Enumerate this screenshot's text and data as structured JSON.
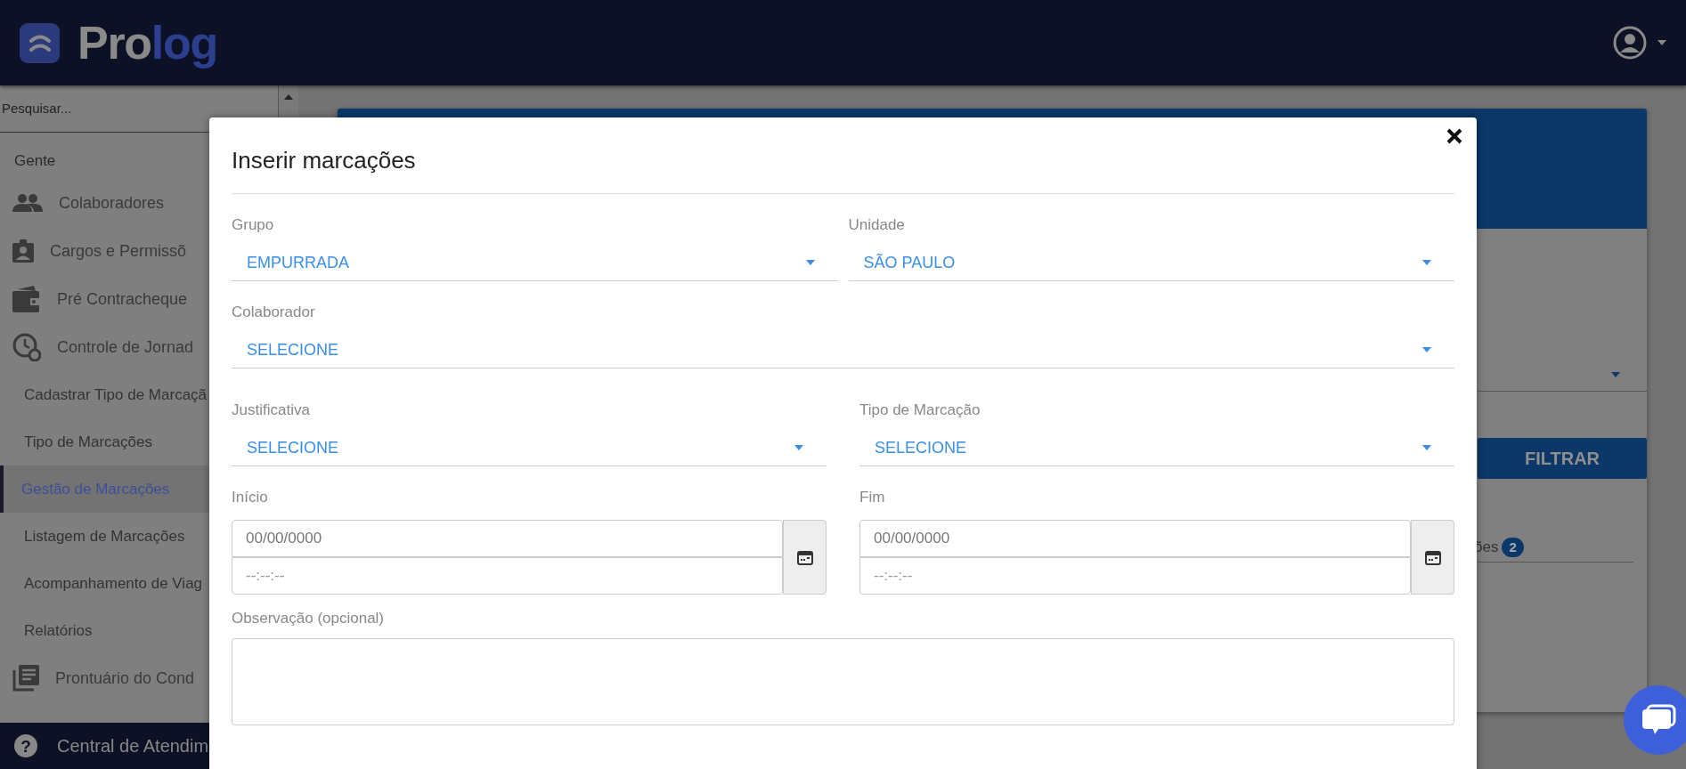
{
  "header": {
    "logo": {
      "parts": [
        "Pro",
        "log"
      ]
    }
  },
  "sidebar": {
    "search": {
      "placeholder": "Pesquisar..."
    },
    "items": [
      {
        "kind": "section",
        "label": "Gente"
      },
      {
        "kind": "main",
        "label": "Colaboradores",
        "selected": false
      },
      {
        "kind": "main",
        "label": "Cargos e Permissõ",
        "selected": false
      },
      {
        "kind": "main",
        "label": "Pré Contracheque",
        "selected": false
      },
      {
        "kind": "main",
        "label": "Controle de Jornad",
        "selected": false
      },
      {
        "kind": "sub",
        "label": "Cadastrar Tipo de Marcaçã",
        "selected": false
      },
      {
        "kind": "sub",
        "label": "Tipo de Marcações",
        "selected": false
      },
      {
        "kind": "sub",
        "label": "Gestão de Marcações",
        "selected": true
      },
      {
        "kind": "sub",
        "label": "Listagem de Marcações",
        "selected": false
      },
      {
        "kind": "sub",
        "label": "Acompanhamento de Viag",
        "selected": false
      },
      {
        "kind": "sub",
        "label": "Relatórios",
        "selected": false
      },
      {
        "kind": "main",
        "label": "Prontuário do Cond",
        "selected": false
      }
    ],
    "footer": {
      "icon": "?",
      "label": "Central de Atendim"
    }
  },
  "background": {
    "filter_button": "FILTRAR",
    "tab_label": "ões",
    "tab_badge": "2"
  },
  "modal": {
    "title": "Inserir marcações",
    "selects": [
      {
        "label": "Grupo",
        "value": "EMPURRADA"
      },
      {
        "label": "Unidade",
        "value": "SÃO PAULO"
      },
      {
        "label": "Colaborador",
        "value": "SELECIONE"
      },
      {
        "label": "Justificativa",
        "value": "SELECIONE"
      },
      {
        "label": "Tipo de Marcação",
        "value": "SELECIONE"
      }
    ],
    "datetimes": [
      {
        "label": "Início",
        "date_placeholder": "00/00/0000",
        "time_placeholder": "--:--:--"
      },
      {
        "label": "Fim",
        "date_placeholder": "00/00/0000",
        "time_placeholder": "--:--:--"
      }
    ],
    "notes": {
      "label": "Observação (opcional)"
    }
  }
}
